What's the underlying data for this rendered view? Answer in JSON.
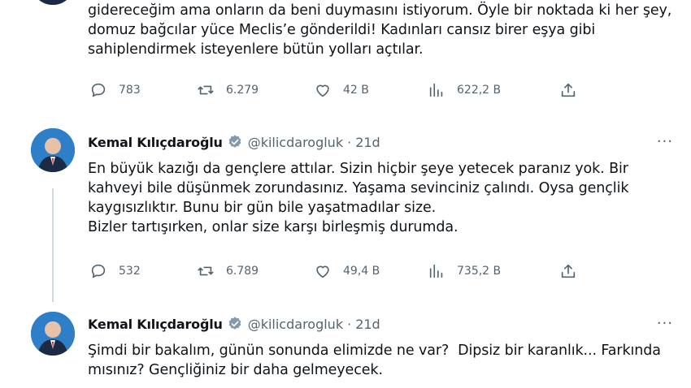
{
  "tweet_top": {
    "text": "gidereceğim ama onların da beni duymasını istiyorum. Öyle bir noktada ki her şey, domuz bağcılar yüce Meclis’e gönderildi! Kadınları cansız birer eşya gibi sahiplendirmek isteyenlere bütün yolları açtılar.",
    "replies": "783",
    "retweets": "6.279",
    "likes": "42 B",
    "views": "622,2 B"
  },
  "tweet_middle": {
    "author": "Kemal Kılıçdaroğlu",
    "handle": "@kilicdarogluk",
    "separator": "·",
    "time": "21d",
    "more": "···",
    "text": "En büyük kazığı da gençlere attılar. Sizin hiçbir şeye yetecek paranız yok. Bir kahveyi bile düşünmek zorundasınız. Yaşama sevinciniz çalındı. Oysa gençlik kaygısızlıktır. Bunu bir gün bile yaşatmadılar size.\nBizler tartışırken, onlar size karşı birleşmiş durumda.",
    "replies": "532",
    "retweets": "6.789",
    "likes": "49,4 B",
    "views": "735,2 B"
  },
  "tweet_bottom": {
    "author": "Kemal Kılıçdaroğlu",
    "handle": "@kilicdarogluk",
    "separator": "·",
    "time": "21d",
    "more": "···",
    "text": "Şimdi bir bakalım, günün sonunda elimizde ne var?  Dipsiz bir karanlık... Farkında mısınız? Gençliğiniz bir daha gelmeyecek."
  },
  "colors": {
    "text": "#0f1419",
    "secondary": "#536471",
    "verified": "#829aab",
    "thread_line": "#cfd9de"
  },
  "icons": [
    "reply-icon",
    "retweet-icon",
    "like-icon",
    "views-icon",
    "share-icon",
    "verified-badge-icon",
    "more-icon"
  ]
}
